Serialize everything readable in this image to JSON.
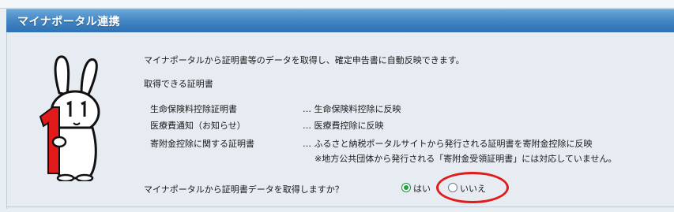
{
  "header": {
    "title": "マイナポータル連携"
  },
  "panel": {
    "intro": "マイナポータルから証明書等のデータを取得し、確定申告書に自動反映できます。",
    "subheading": "取得できる証明書",
    "rows": [
      {
        "name": "生命保険料控除証明書",
        "desc": "… 生命保険料控除に反映"
      },
      {
        "name": "医療費通知（お知らせ）",
        "desc": "… 医療費控除に反映"
      },
      {
        "name": "寄附金控除に関する証明書",
        "desc": "… ふるさと納税ポータルサイトから発行される証明書を寄附金控除に反映"
      }
    ],
    "note": "※地方公共団体から発行される「寄附金受領証明書」には対応していません。",
    "question": "マイナポータルから証明書データを取得しますか？",
    "options": [
      {
        "label": "はい",
        "selected": true
      },
      {
        "label": "いいえ",
        "selected": false
      }
    ]
  },
  "colors": {
    "header": "#3f83c2",
    "panel": "#e6ecf2",
    "radio_selected": "#22a33f",
    "highlight": "#e11b1b"
  }
}
